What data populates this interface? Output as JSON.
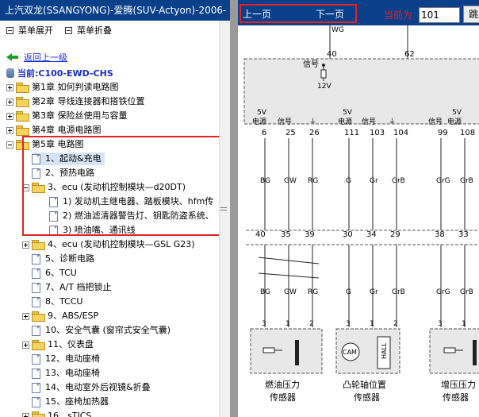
{
  "window": {
    "title": "上汽双龙(SSANGYONG)-爱腾(SUV-Actyon)-2006-"
  },
  "toolbar": {
    "expand_label": "菜单展开",
    "collapse_label": "菜单折叠"
  },
  "nav": {
    "back_label": "返回上一级",
    "current_label": "当前:C100-EWD-CHS"
  },
  "tree": {
    "chapters": [
      {
        "label": "第1章 如何判读电路图"
      },
      {
        "label": "第2章 导线连接器和搭铁位置"
      },
      {
        "label": "第3章 保险丝使用与容量"
      },
      {
        "label": "第4章 电源电路图"
      },
      {
        "label": "第5章 电路图"
      }
    ],
    "items": [
      {
        "label": "1、起动&充电"
      },
      {
        "label": "2、预热电路"
      },
      {
        "label": "3、ecu (发动机控制模块—d20DT)"
      },
      {
        "label": "1) 发动机主继电器、踏板模块、hfm传"
      },
      {
        "label": "2) 燃油滤清器警告灯、钥匙防盗系统、"
      },
      {
        "label": "3) 喷油嘴、通讯线"
      },
      {
        "label": "4、ecu (发动机控制模块—GSL G23)"
      },
      {
        "label": "5、诊断电路"
      },
      {
        "label": "6、TCU"
      },
      {
        "label": "7、A/T 档把锁止"
      },
      {
        "label": "8、TCCU"
      },
      {
        "label": "9、ABS/ESP"
      },
      {
        "label": "10、安全气囊 (窗帘式安全气囊)"
      },
      {
        "label": "11、仪表盘"
      },
      {
        "label": "12、电动座椅"
      },
      {
        "label": "13、电动座椅"
      },
      {
        "label": "14、电动室外后视镜&折叠"
      },
      {
        "label": "15、座椅加热器"
      },
      {
        "label": "16、sTICS"
      }
    ]
  },
  "viewer": {
    "prev_label": "上一页",
    "next_label": "下一页",
    "current_page_label": "当前为",
    "page_value": "101",
    "jump_label": "跳"
  },
  "diagram": {
    "top_wires": [
      "40",
      "62"
    ],
    "top_left_label": "WG",
    "signal_label": "信号",
    "voltage_label": "12V",
    "pin_headers": [
      "5V\n电源",
      "信号",
      "⏚",
      "5V\n电源",
      "信号",
      "⏚",
      "5V\n电源",
      "信号",
      "⏚"
    ],
    "upper_pins": [
      "6",
      "25",
      "26",
      "111",
      "103",
      "104",
      "99",
      "108"
    ],
    "wire_colors_top": [
      "BG",
      "GW",
      "RG",
      "G",
      "Gr",
      "GrB",
      "GrG",
      "GrB"
    ],
    "lower_pins": [
      "40",
      "35",
      "39",
      "30",
      "34",
      "29",
      "38",
      "33"
    ],
    "wire_colors_bottom": [
      "BG",
      "GW",
      "RG",
      "G",
      "Gr",
      "GrB",
      "GrG",
      "GrB"
    ],
    "connector_pins": [
      "3",
      "1",
      "2",
      "3",
      "1",
      "2",
      "3",
      "1"
    ],
    "sensor_labels": [
      {
        "line1": "燃油压力",
        "line2": "传感器"
      },
      {
        "line1": "凸轮轴位置",
        "line2": "传感器"
      },
      {
        "line1": "增压压力",
        "line2": "传感器"
      }
    ],
    "cam_label": "CAM",
    "hall_label": "HALL",
    "colors": {
      "wire": "#222222",
      "box_fill": "#e8e8e8",
      "dash": "#555555"
    }
  }
}
